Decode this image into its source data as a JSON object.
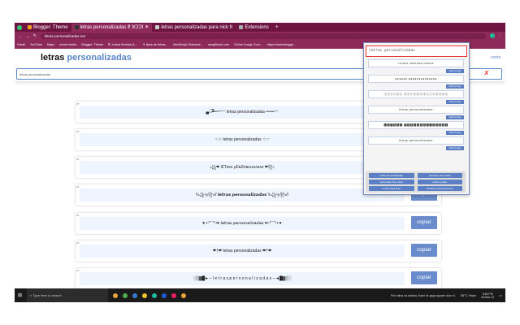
{
  "browser": {
    "tabs": [
      {
        "label": "Blogger: Theme"
      },
      {
        "label": "letras personalizadas 𝕷 ꓘƆƆI ⚜",
        "active": true
      },
      {
        "label": "letras personalizadas para nick fr"
      },
      {
        "label": "Extensions"
      }
    ],
    "url": "letras-personalizadas.net",
    "bookmarks": [
      "Gmail",
      "YouTube",
      "Maps",
      "social media",
      "Blogger: Theme",
      "Ꮭr Letras Bonitas (L...",
      "✦ tipos de letras...",
      "JavaScript Obfuscat...",
      "rawgithack.com",
      "Online Image Com...",
      "https://www.blogge..."
    ]
  },
  "site": {
    "logo_a": "letras",
    "logo_b": "personalizadas",
    "contact": "conte",
    "search_value": "letras personalizadas",
    "clear": "X",
    "cards": [
      {
        "num": "27",
        "text": "▄︻̷̿┻̿═━一 letras personalizadas ══━一"
      },
      {
        "num": "27",
        "text": "☜☆ letras personalizadas ☆☞"
      },
      {
        "num": "27",
        "text": "꧁❤ ƖƐƬʀᴀѕ ρƐʀƧᴏɴᴀʟɪᴢᴀᴅᴀѕ ❤꧂"
      },
      {
        "num": "27",
        "text": "\\\\꧁ఌ꧂// 𝙡𝙚𝙩𝙧𝙖𝙨 𝙥𝙚𝙧𝙨𝙤𝙣𝙖𝙡𝙞𝙯𝙖𝙙𝙖𝙨 \\\\꧁ఌ꧂//",
        "copy": "copiar"
      },
      {
        "num": "27",
        "text": "♥.•:*¨¨*:•♥ 𝘭𝘦𝘵𝘳𝘢𝘴 𝘱𝘦𝘳𝘴𝘰𝘯𝘢𝘭𝘪𝘻𝘢𝘥𝘢𝘴 ♥•:*¨¨*:•.♥",
        "copy": "copiar"
      },
      {
        "num": "27",
        "text": "❤†❤ letras personalizadas ❤†❤",
        "copy": "copiar"
      },
      {
        "num": "27",
        "text": "░▒▓█►─ l e t r a s  p e r s o n a l i z a d a s ─◄█▓▒░",
        "copy": "copiar"
      }
    ]
  },
  "popup": {
    "input": "letras personalizadas",
    "items": [
      "ʟᴇᴛʀᴀs ᴘᴇʀsᴏɴᴀʟɪᴢᴀᴅᴀs",
      "●●●●●● ●●●●●●●●●●●●●●",
      "ⓛⓔⓣⓡⓐⓢ ⓟⓔⓡⓢⓞⓝⓐⓛⓘⓩⓐⓓⓐⓢ",
      "letras personalizadas",
      "🅻🅴🆃🆁🅰🆂 🅿🅴🆁🆂🅾🅽🅰🅻🅸🆉🅰🅳🅰🆂",
      "letras personalizadas"
    ],
    "copy": "Click to Copy",
    "links": [
      "letras personalizadas",
      "Convertor De Letras",
      "Generador De Letras",
      "letras bonitas",
      "Letras Para Nick",
      "Nombres Para Free Fire"
    ]
  },
  "taskbar": {
    "search": "Type here to search",
    "news": "Phir milna na dobara, Kami ho gaya apparn door si...",
    "weather": "36°C Haze",
    "time": "3:48 PM",
    "date": "26-Mar-22"
  }
}
